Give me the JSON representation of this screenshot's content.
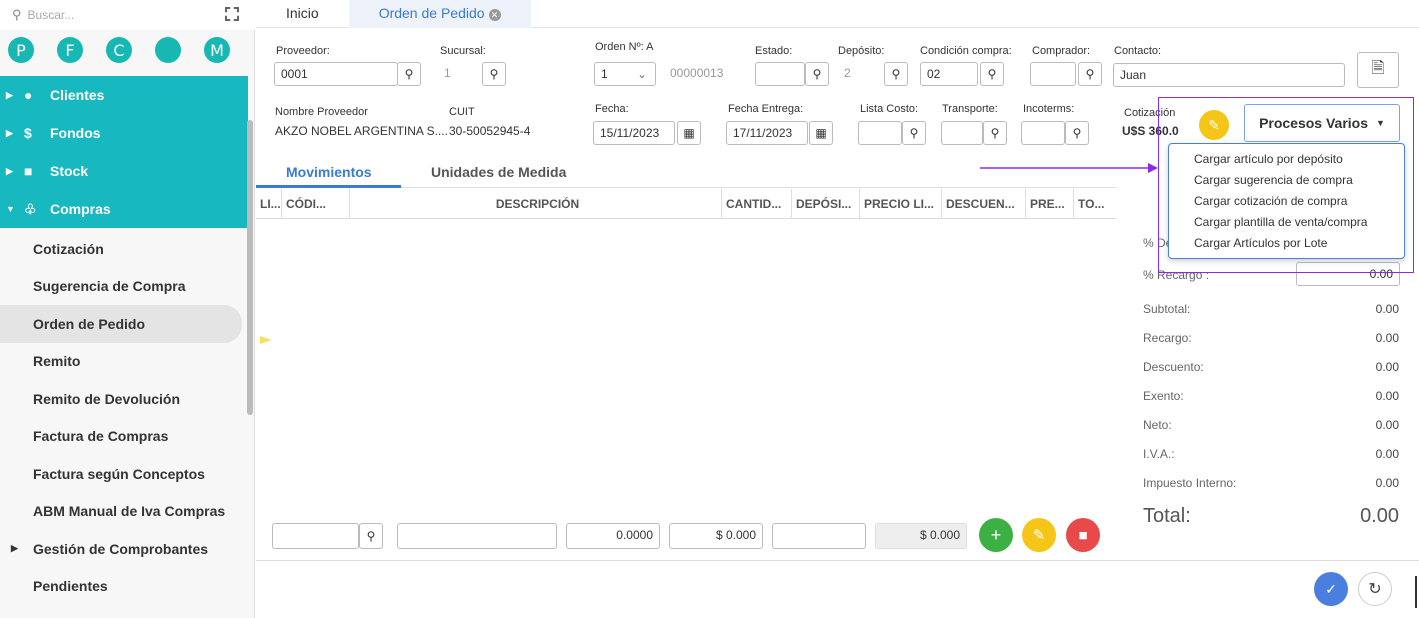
{
  "search": {
    "placeholder": "Buscar..."
  },
  "circles": [
    "P",
    "F",
    "C",
    "",
    "M"
  ],
  "menu": {
    "clientes": "Clientes",
    "fondos": "Fondos",
    "stock": "Stock",
    "compras": "Compras",
    "sub": [
      "Cotización",
      "Sugerencia de Compra",
      "Orden de Pedido",
      "Remito",
      "Remito de Devolución",
      "Factura de Compras",
      "Factura según Conceptos",
      "ABM Manual de Iva Compras",
      "Gestión de Comprobantes",
      "Pendientes"
    ]
  },
  "tabs": {
    "inicio": "Inicio",
    "orden": "Orden de Pedido"
  },
  "form": {
    "proveedor_lbl": "Proveedor:",
    "proveedor": "0001",
    "sucursal_lbl": "Sucursal:",
    "sucursal": "1",
    "orden_lbl": "Orden Nº: A",
    "orden_sel": "1",
    "orden_num": "00000013",
    "estado_lbl": "Estado:",
    "deposito_lbl": "Depósito:",
    "deposito": "2",
    "condicion_lbl": "Condición compra:",
    "condicion": "02",
    "comprador_lbl": "Comprador:",
    "contacto_lbl": "Contacto:",
    "contacto": "Juan",
    "nombre_lbl": "Nombre Proveedor",
    "nombre": "AKZO NOBEL ARGENTINA S....",
    "cuit_lbl": "CUIT",
    "cuit": "30-50052945-4",
    "fecha_lbl": "Fecha:",
    "fecha": "15/11/2023",
    "entrega_lbl": "Fecha Entrega:",
    "entrega": "17/11/2023",
    "lista_lbl": "Lista Costo:",
    "transporte_lbl": "Transporte:",
    "incoterms_lbl": "Incoterms:",
    "cotizacion_lbl": "Cotización",
    "cotizacion": "U$S 360.0"
  },
  "procesos": {
    "label": "Procesos Varios",
    "items": [
      "Cargar artículo por depósito",
      "Cargar sugerencia de compra",
      "Cargar cotización de compra",
      "Cargar plantilla de venta/compra",
      "Cargar Artículos por Lote"
    ]
  },
  "subtabs": {
    "movimientos": "Movimientos",
    "unidades": "Unidades de Medida"
  },
  "columns": [
    "LI...",
    "CÓDI...",
    "DESCRIPCIÓN",
    "CANTID...",
    "DEPÓSI...",
    "PRECIO LI...",
    "DESCUEN...",
    "PRE...",
    "TO..."
  ],
  "bottom": {
    "cantidad": "0.0000",
    "precio": "$ 0.000",
    "total": "$ 0.000"
  },
  "summary": {
    "descuento_lbl": "% De",
    "recargo_lbl": "% Recargo :",
    "recargo": "0.00",
    "rows": [
      {
        "l": "Subtotal:",
        "v": "0.00"
      },
      {
        "l": "Recargo:",
        "v": "0.00"
      },
      {
        "l": "Descuento:",
        "v": "0.00"
      },
      {
        "l": "Exento:",
        "v": "0.00"
      },
      {
        "l": "Neto:",
        "v": "0.00"
      },
      {
        "l": "I.V.A.:",
        "v": "0.00"
      },
      {
        "l": "Impuesto Interno:",
        "v": "0.00"
      }
    ],
    "total_lbl": "Total:",
    "total": "0.00"
  }
}
